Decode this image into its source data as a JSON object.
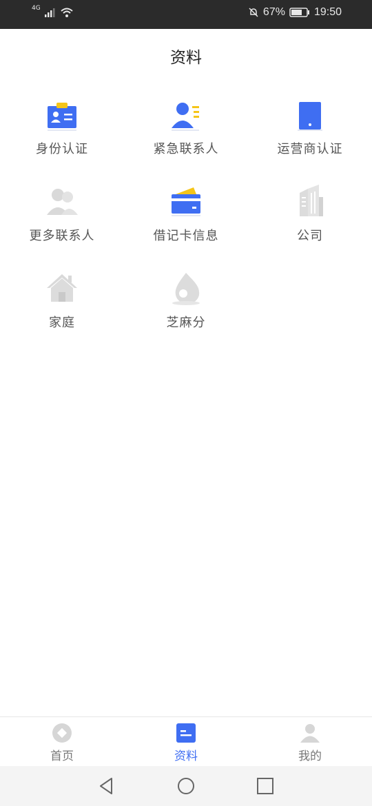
{
  "status_bar": {
    "network": "4G",
    "battery_percent": "67%",
    "time": "19:50"
  },
  "header": {
    "title": "资料"
  },
  "grid_items": [
    {
      "label": "身份认证",
      "icon": "id-card-icon",
      "completed": true
    },
    {
      "label": "紧急联系人",
      "icon": "emergency-contact-icon",
      "completed": true
    },
    {
      "label": "运营商认证",
      "icon": "phone-carrier-icon",
      "completed": true
    },
    {
      "label": "更多联系人",
      "icon": "more-contacts-icon",
      "completed": false
    },
    {
      "label": "借记卡信息",
      "icon": "debit-card-icon",
      "completed": true
    },
    {
      "label": "公司",
      "icon": "company-building-icon",
      "completed": false
    },
    {
      "label": "家庭",
      "icon": "home-icon",
      "completed": false
    },
    {
      "label": "芝麻分",
      "icon": "sesame-score-icon",
      "completed": false
    }
  ],
  "tabbar": {
    "tabs": [
      {
        "label": "首页",
        "icon": "home-tab-icon",
        "active": false
      },
      {
        "label": "资料",
        "icon": "profile-data-tab-icon",
        "active": true
      },
      {
        "label": "我的",
        "icon": "user-tab-icon",
        "active": false
      }
    ]
  },
  "colors": {
    "accent": "#3f6ef2",
    "yellow": "#f5c518",
    "inactive_icon": "#d9d9d9",
    "tab_active": "#3f6ef2",
    "tab_inactive": "#777777"
  }
}
